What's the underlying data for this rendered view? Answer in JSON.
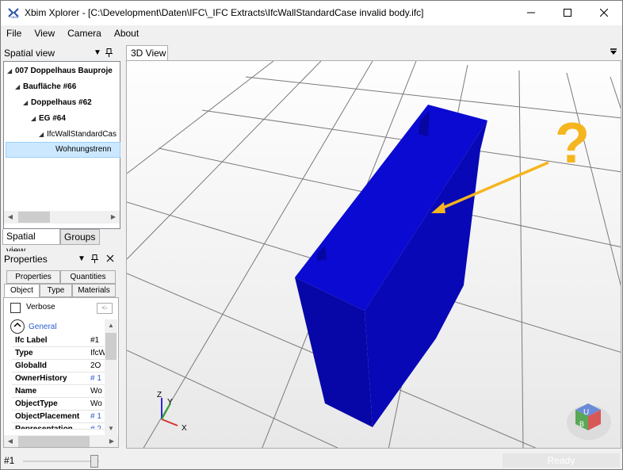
{
  "window": {
    "title": "Xbim Xplorer - [C:\\Development\\Daten\\IFC\\_IFC Extracts\\IfcWallStandardCase invalid body.ifc]"
  },
  "menu": [
    "File",
    "View",
    "Camera",
    "About"
  ],
  "spatial_panel": {
    "title": "Spatial view",
    "tree": [
      {
        "label": "007 Doppelhaus Bauproje",
        "bold": true
      },
      {
        "label": "Baufläche #66",
        "bold": true
      },
      {
        "label": "Doppelhaus #62",
        "bold": true
      },
      {
        "label": "EG #64",
        "bold": true
      },
      {
        "label": "IfcWallStandardCas",
        "bold": false
      },
      {
        "label": "Wohnungstrenn",
        "bold": false,
        "selected": true
      }
    ],
    "tabs": [
      "Spatial view",
      "Groups"
    ]
  },
  "properties_panel": {
    "title": "Properties",
    "tabs_top": [
      "Properties",
      "Quantities"
    ],
    "tabs_bottom": [
      "Object",
      "Type",
      "Materials"
    ],
    "verbose_label": "Verbose",
    "back_button": "<-",
    "section": "General",
    "rows": [
      {
        "key": "Ifc Label",
        "value": "#1",
        "link": false
      },
      {
        "key": "Type",
        "value": "IfcW",
        "link": false
      },
      {
        "key": "GlobalId",
        "value": "2O",
        "link": false
      },
      {
        "key": "OwnerHistory",
        "value": "# 1",
        "link": true
      },
      {
        "key": "Name",
        "value": "Wo",
        "link": false
      },
      {
        "key": "ObjectType",
        "value": "Wo",
        "link": false
      },
      {
        "key": "ObjectPlacement",
        "value": "# 1",
        "link": true
      },
      {
        "key": "Representation",
        "value": "# 2",
        "link": true
      }
    ]
  },
  "view": {
    "tab": "3D View",
    "annotation": "?",
    "axes": {
      "x": "X",
      "y": "Y",
      "z": "Z"
    },
    "navcube": {
      "top": "U",
      "front": "B"
    }
  },
  "status": {
    "entity": "#1",
    "state": "Ready"
  },
  "colors": {
    "wall": "#0a0ad2",
    "annotation": "#f5b51e"
  }
}
